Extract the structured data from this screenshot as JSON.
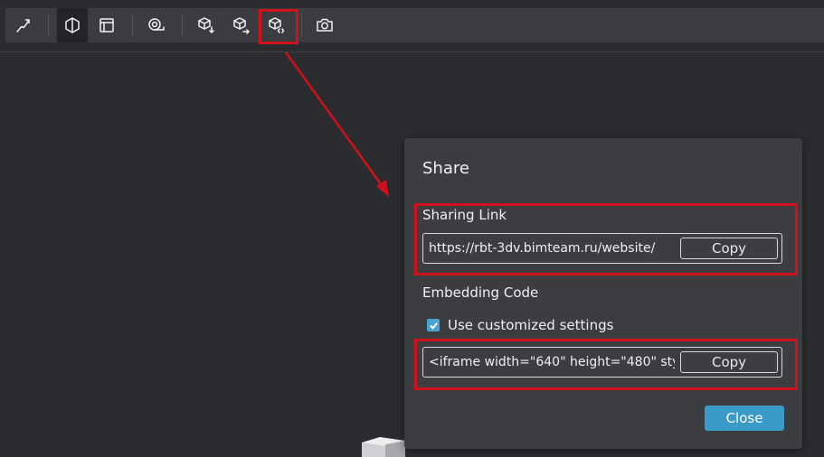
{
  "toolbar": {
    "buttons": [
      {
        "name": "measure-icon"
      },
      {
        "name": "cube-view-icon",
        "active": true
      },
      {
        "name": "section-box-icon",
        "active": true
      },
      {
        "name": "tape-measure-icon"
      },
      {
        "name": "model-explode-icon"
      },
      {
        "name": "model-share-icon"
      },
      {
        "name": "embed-code-icon"
      },
      {
        "name": "camera-icon"
      }
    ]
  },
  "dialog": {
    "title": "Share",
    "sharing_link": {
      "label": "Sharing Link",
      "value": "https://rbt-3dv.bimteam.ru/website/",
      "copy_label": "Copy"
    },
    "embedding_code": {
      "label": "Embedding Code",
      "checkbox_label": "Use customized settings",
      "checked": true,
      "value": "<iframe width=\"640\" height=\"480\" sty",
      "copy_label": "Copy"
    },
    "close_label": "Close"
  },
  "colors": {
    "background": "#2b2c2f",
    "dialog": "#3c3d41",
    "highlight": "#d0101a",
    "accent": "#3a9ac8"
  }
}
